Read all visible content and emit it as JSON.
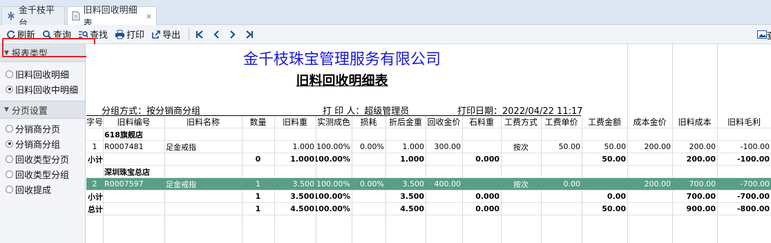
{
  "tabs": [
    {
      "label": "金千枝平台",
      "icon": "dragon-logo-icon"
    },
    {
      "label": "旧料回收明细表",
      "icon": "document-icon",
      "close": "×"
    }
  ],
  "toolbar": {
    "refresh": "刷新",
    "query": "查询",
    "find": "查找",
    "print": "打印",
    "export": "导出",
    "right_label": "查"
  },
  "sidebar": {
    "report_type": {
      "title": "报表类型",
      "options": [
        "旧料回收明细",
        "旧料回收中明细"
      ],
      "selected": 1
    },
    "paging": {
      "title": "分页设置",
      "options": [
        "分销商分页",
        "分销商分组",
        "回收类型分页",
        "回收类型分组",
        "回收提成"
      ],
      "selected": 1
    }
  },
  "report": {
    "company": "金千枝珠宝管理服务有限公司",
    "title": "旧料回收明细表",
    "group_by": "分组方式：按分销商分组",
    "printer": "打 印 人：超级管理员",
    "print_date": "打印日期：2022/04/22 11:17",
    "columns": [
      "字号",
      "旧料编号",
      "旧料名称",
      "数量",
      "旧料重",
      "实测成色",
      "损耗",
      "折后金重",
      "回收金价",
      "石料重",
      "工费方式",
      "工费单价",
      "工费金额",
      "成本金价",
      "旧料成本",
      "旧料毛利"
    ],
    "rows": [
      {
        "type": "group",
        "cells": [
          "",
          "618旗舰店",
          "",
          "",
          "",
          "",
          "",
          "",
          "",
          "",
          "",
          "",
          "",
          "",
          "",
          ""
        ]
      },
      {
        "type": "data",
        "cells": [
          "1",
          "R0007481",
          "足金戒指",
          "",
          "1.000",
          "100.00%",
          "0.00%",
          "1.000",
          "300.00",
          "",
          "按次",
          "50.00",
          "50.00",
          "200.00",
          "200.00",
          "-100.00"
        ]
      },
      {
        "type": "sub",
        "cells": [
          "小计",
          "",
          "",
          "0",
          "1.000",
          "100.00%",
          "",
          "1.000",
          "",
          "0.000",
          "",
          "",
          "50.00",
          "",
          "200.00",
          "-100.00"
        ]
      },
      {
        "type": "group",
        "cells": [
          "",
          "深圳珠宝总店",
          "",
          "",
          "",
          "",
          "",
          "",
          "",
          "",
          "",
          "",
          "",
          "",
          "",
          ""
        ]
      },
      {
        "type": "sel",
        "cells": [
          "2",
          "R0007597",
          "足金戒指",
          "1",
          "3.500",
          "100.00%",
          "0.00%",
          "3.500",
          "400.00",
          "",
          "按次",
          "0.00",
          "",
          "200.00",
          "700.00",
          "-700.00"
        ]
      },
      {
        "type": "sub",
        "cells": [
          "小计",
          "",
          "",
          "1",
          "3.500",
          "100.00%",
          "",
          "3.500",
          "",
          "0.000",
          "",
          "",
          "0.00",
          "",
          "700.00",
          "-700.00"
        ]
      },
      {
        "type": "tot",
        "cells": [
          "总计",
          "",
          "",
          "1",
          "4.500",
          "100.00%",
          "",
          "4.500",
          "",
          "0.000",
          "",
          "",
          "50.00",
          "",
          "900.00",
          "-800.00"
        ]
      }
    ]
  },
  "colors": {
    "company": "#1a1ad6",
    "selected_row": "#5a9e86",
    "highlight_box": "#e02020"
  }
}
